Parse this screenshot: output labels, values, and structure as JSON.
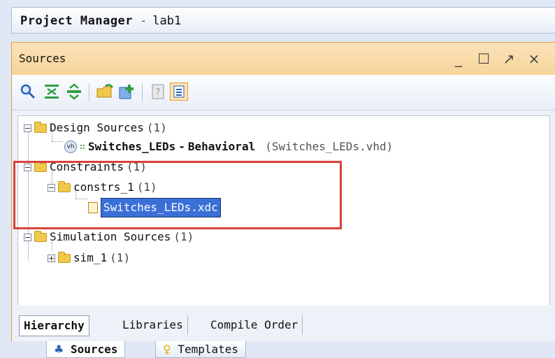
{
  "header": {
    "title": "Project Manager",
    "separator": "-",
    "project": "lab1"
  },
  "panel": {
    "title": "Sources",
    "controls": {
      "minimize": "_",
      "maximize": "☐",
      "float": "↗",
      "close": "×"
    }
  },
  "toolbar": {
    "icons": [
      "search-icon",
      "collapse-all-icon",
      "expand-all-icon",
      "open-folder-icon",
      "add-sources-icon",
      "properties-icon",
      "show-hierarchy-icon"
    ]
  },
  "tree": {
    "design_sources": {
      "label": "Design Sources",
      "count": "(1)"
    },
    "top_module": {
      "name": "Switches_LEDs",
      "dash": "-",
      "arch": "Behavioral",
      "file": "(Switches_LEDs.vhd)",
      "icon_text": "vh"
    },
    "constraints": {
      "label": "Constraints",
      "count": "(1)"
    },
    "constrs_1": {
      "label": "constrs_1",
      "count": "(1)"
    },
    "xdc_file": {
      "label": "Switches_LEDs.xdc"
    },
    "simulation_sources": {
      "label": "Simulation Sources",
      "count": "(1)"
    },
    "sim_1": {
      "label": "sim_1",
      "count": "(1)"
    }
  },
  "view_tabs": [
    "Hierarchy",
    "Libraries",
    "Compile Order"
  ],
  "outer_tabs": [
    "Sources",
    "Templates"
  ],
  "colors": {
    "highlight": "#d9413d",
    "selection": "#3a6fd8",
    "panel_title": "#f6d49b"
  }
}
